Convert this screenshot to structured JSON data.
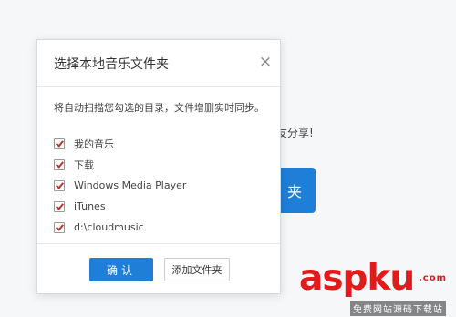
{
  "background": {
    "share_text": "朋友分享!",
    "button_label": "夹"
  },
  "dialog": {
    "title": "选择本地音乐文件夹",
    "close_icon": "×",
    "description": "将自动扫描您勾选的目录，文件增删实时同步。",
    "folders": [
      {
        "label": "我的音乐",
        "checked": true
      },
      {
        "label": "下载",
        "checked": true
      },
      {
        "label": "Windows Media Player",
        "checked": true
      },
      {
        "label": "iTunes",
        "checked": true
      },
      {
        "label": "d:\\cloudmusic",
        "checked": true
      }
    ],
    "confirm_label": "确认",
    "add_folder_label": "添加文件夹"
  },
  "watermark": {
    "main": "aspku",
    "domain": ".com",
    "sub": "免费网站源码下载站"
  },
  "colors": {
    "accent": "#1e7ed8",
    "check": "#b3362a",
    "watermark": "#e01b1b"
  }
}
